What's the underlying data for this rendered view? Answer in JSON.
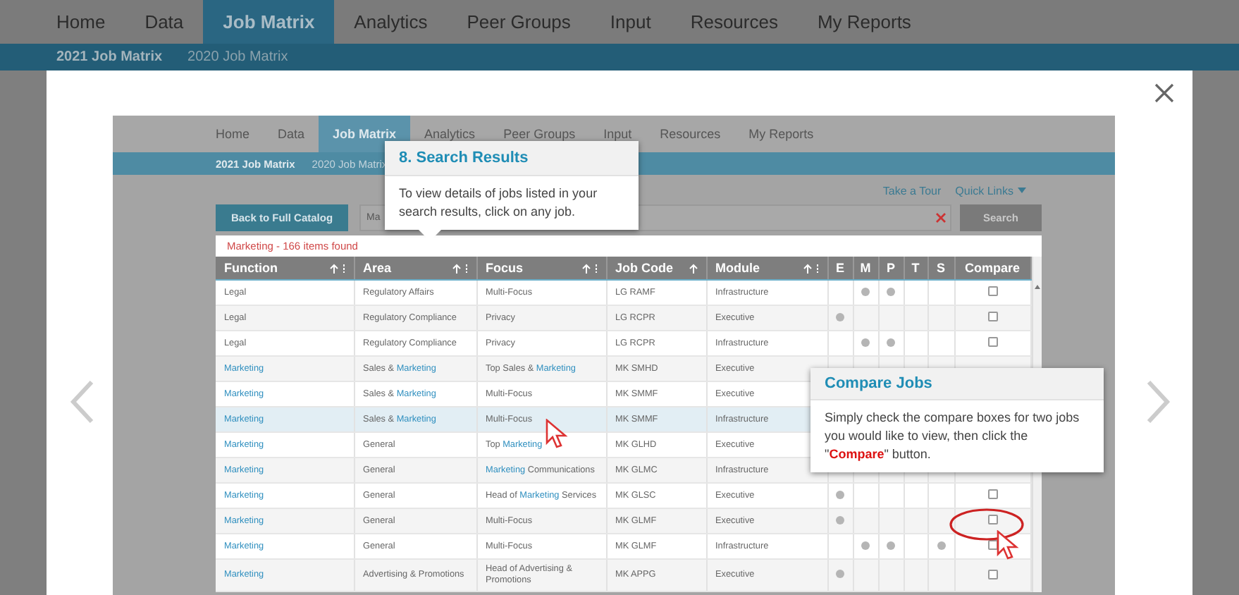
{
  "top_nav": {
    "items": [
      {
        "label": "Home",
        "selected": false
      },
      {
        "label": "Data",
        "selected": false
      },
      {
        "label": "Job Matrix",
        "selected": true
      },
      {
        "label": "Analytics",
        "selected": false
      },
      {
        "label": "Peer Groups",
        "selected": false
      },
      {
        "label": "Input",
        "selected": false
      },
      {
        "label": "Resources",
        "selected": false
      },
      {
        "label": "My Reports",
        "selected": false
      }
    ]
  },
  "sub_nav": {
    "items": [
      {
        "label": "2021 Job Matrix",
        "selected": true
      },
      {
        "label": "2020 Job Matrix",
        "selected": false
      }
    ]
  },
  "modal": {
    "tour": {
      "nav": {
        "items": [
          {
            "label": "Home",
            "selected": false
          },
          {
            "label": "Data",
            "selected": false
          },
          {
            "label": "Job Matrix",
            "selected": true
          },
          {
            "label": "Analytics",
            "selected": false
          },
          {
            "label": "Peer Groups",
            "selected": false
          },
          {
            "label": "Input",
            "selected": false
          },
          {
            "label": "Resources",
            "selected": false
          },
          {
            "label": "My Reports",
            "selected": false
          }
        ]
      },
      "sub_nav": {
        "items": [
          {
            "label": "2021 Job Matrix",
            "selected": true
          },
          {
            "label": "2020 Job Matrix",
            "selected": false
          }
        ]
      },
      "links": [
        {
          "label": "Take a Tour",
          "dropdown": false
        },
        {
          "label": "Quick Links",
          "dropdown": true
        }
      ],
      "back_button": "Back to Full Catalog",
      "search": {
        "value": "Ma",
        "button": "Search"
      },
      "result_summary": "Marketing - 166 items found",
      "table": {
        "columns": [
          {
            "label": "Function",
            "kind": "sort_menu"
          },
          {
            "label": "Area",
            "kind": "sort_menu"
          },
          {
            "label": "Focus",
            "kind": "sort_menu"
          },
          {
            "label": "Job Code",
            "kind": "sort"
          },
          {
            "label": "Module",
            "kind": "sort_menu"
          },
          {
            "label": "E",
            "kind": "plain"
          },
          {
            "label": "M",
            "kind": "plain"
          },
          {
            "label": "P",
            "kind": "plain"
          },
          {
            "label": "T",
            "kind": "plain"
          },
          {
            "label": "S",
            "kind": "plain"
          },
          {
            "label": "Compare",
            "kind": "plain"
          }
        ],
        "rows": [
          {
            "selected": false,
            "function": [
              {
                "text": "Legal",
                "link": false
              }
            ],
            "area": [
              {
                "text": "Regulatory Affairs",
                "link": false
              }
            ],
            "focus": [
              {
                "text": "Multi-Focus",
                "link": false
              }
            ],
            "job_code": "LG RAMF",
            "module": "Infrastructure",
            "levels": {
              "e": false,
              "m": true,
              "p": true,
              "t": false,
              "s": false
            },
            "compare": {
              "checked": false
            }
          },
          {
            "selected": false,
            "function": [
              {
                "text": "Legal",
                "link": false
              }
            ],
            "area": [
              {
                "text": "Regulatory Compliance",
                "link": false
              }
            ],
            "focus": [
              {
                "text": "Privacy",
                "link": false
              }
            ],
            "job_code": "LG RCPR",
            "module": "Executive",
            "levels": {
              "e": true,
              "m": false,
              "p": false,
              "t": false,
              "s": false
            },
            "compare": {
              "checked": false
            }
          },
          {
            "selected": false,
            "function": [
              {
                "text": "Legal",
                "link": false
              }
            ],
            "area": [
              {
                "text": "Regulatory Compliance",
                "link": false
              }
            ],
            "focus": [
              {
                "text": "Privacy",
                "link": false
              }
            ],
            "job_code": "LG RCPR",
            "module": "Infrastructure",
            "levels": {
              "e": false,
              "m": true,
              "p": true,
              "t": false,
              "s": false
            },
            "compare": {
              "checked": false
            }
          },
          {
            "selected": false,
            "function": [
              {
                "text": "Marketing",
                "link": true
              }
            ],
            "area": [
              {
                "text": "Sales & ",
                "link": false
              },
              {
                "text": "Marketing",
                "link": true
              }
            ],
            "focus": [
              {
                "text": "Top Sales & ",
                "link": false
              },
              {
                "text": "Marketing",
                "link": true
              }
            ],
            "job_code": "MK SMHD",
            "module": "Executive"
          },
          {
            "selected": false,
            "function": [
              {
                "text": "Marketing",
                "link": true
              }
            ],
            "area": [
              {
                "text": "Sales & ",
                "link": false
              },
              {
                "text": "Marketing",
                "link": true
              }
            ],
            "focus": [
              {
                "text": "Multi-Focus",
                "link": false
              }
            ],
            "job_code": "MK SMMF",
            "module": "Executive"
          },
          {
            "selected": true,
            "function": [
              {
                "text": "Marketing",
                "link": true
              }
            ],
            "area": [
              {
                "text": "Sales & ",
                "link": false
              },
              {
                "text": "Marketing",
                "link": true
              }
            ],
            "focus": [
              {
                "text": "Multi-Focus",
                "link": false
              }
            ],
            "job_code": "MK SMMF",
            "module": "Infrastructure"
          },
          {
            "selected": false,
            "function": [
              {
                "text": "Marketing",
                "link": true
              }
            ],
            "area": [
              {
                "text": "General",
                "link": false
              }
            ],
            "focus": [
              {
                "text": "Top ",
                "link": false
              },
              {
                "text": "Marketing",
                "link": true
              }
            ],
            "job_code": "MK GLHD",
            "module": "Executive"
          },
          {
            "selected": false,
            "function": [
              {
                "text": "Marketing",
                "link": true
              }
            ],
            "area": [
              {
                "text": "General",
                "link": false
              }
            ],
            "focus": [
              {
                "text": "Marketing",
                "link": true
              },
              {
                "text": " Communications",
                "link": false
              }
            ],
            "job_code": "MK GLMC",
            "module": "Infrastructure"
          },
          {
            "selected": false,
            "function": [
              {
                "text": "Marketing",
                "link": true
              }
            ],
            "area": [
              {
                "text": "General",
                "link": false
              }
            ],
            "focus": [
              {
                "text": "Head of ",
                "link": false
              },
              {
                "text": "Marketing",
                "link": true
              },
              {
                "text": " Services",
                "link": false
              }
            ],
            "job_code": "MK GLSC",
            "module": "Executive",
            "levels": {
              "e": true,
              "m": false,
              "p": false,
              "t": false,
              "s": false
            },
            "compare": {
              "checked": false
            }
          },
          {
            "selected": false,
            "function": [
              {
                "text": "Marketing",
                "link": true
              }
            ],
            "area": [
              {
                "text": "General",
                "link": false
              }
            ],
            "focus": [
              {
                "text": "Multi-Focus",
                "link": false
              }
            ],
            "job_code": "MK GLMF",
            "module": "Executive",
            "levels": {
              "e": true,
              "m": false,
              "p": false,
              "t": false,
              "s": false
            },
            "compare": {
              "checked": false
            }
          },
          {
            "selected": false,
            "function": [
              {
                "text": "Marketing",
                "link": true
              }
            ],
            "area": [
              {
                "text": "General",
                "link": false
              }
            ],
            "focus": [
              {
                "text": "Multi-Focus",
                "link": false
              }
            ],
            "job_code": "MK GLMF",
            "module": "Infrastructure",
            "levels": {
              "e": false,
              "m": true,
              "p": true,
              "t": false,
              "s": true
            },
            "compare": {
              "checked": false
            }
          },
          {
            "selected": false,
            "function": [
              {
                "text": "Marketing",
                "link": true
              }
            ],
            "area": [
              {
                "text": "Advertising & Promotions",
                "link": false
              }
            ],
            "focus": [
              {
                "text": "Head of Advertising & Promotions",
                "link": false
              }
            ],
            "job_code": "MK APPG",
            "module": "Executive",
            "levels": {
              "e": true,
              "m": false,
              "p": false,
              "t": false,
              "s": false
            },
            "compare": {
              "checked": false
            }
          }
        ]
      },
      "tooltips": [
        {
          "title": "8. Search Results",
          "text": "To view details of jobs listed in your search results, click on any job."
        },
        {
          "title": "Compare Jobs",
          "text": "Simply check the compare boxes for two jobs you would like to view, then click the \"**Compare**\" button."
        }
      ]
    }
  }
}
